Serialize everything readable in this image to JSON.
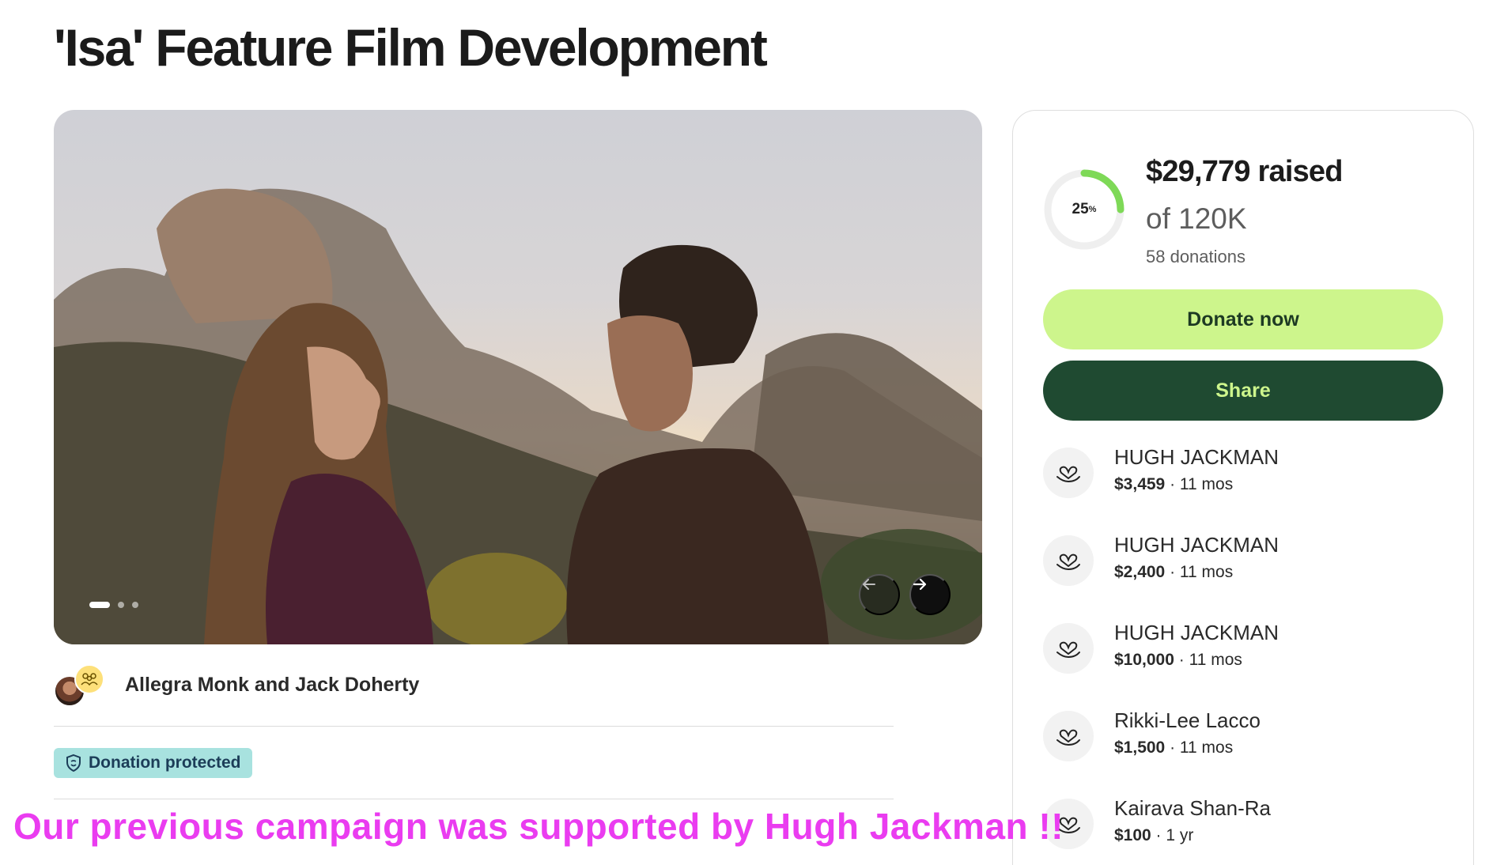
{
  "title": "'Isa' Feature Film Development",
  "gallery": {
    "slide_count": 3,
    "active_index": 0
  },
  "organizer": {
    "name": "Allegra Monk and Jack Doherty"
  },
  "protection": {
    "label": "Donation protected"
  },
  "overlay": {
    "text": "Our previous campaign was supported by Hugh Jackman !!"
  },
  "fundraiser": {
    "progress_percent": 25,
    "progress_label": "25",
    "progress_unit": "%",
    "raised_text": "$29,779 raised",
    "goal_text": "of 120K",
    "donations_text": "58 donations",
    "donate_label": "Donate now",
    "share_label": "Share"
  },
  "donations": [
    {
      "name": "HUGH JACKMAN",
      "amount": "$3,459",
      "age": "11 mos"
    },
    {
      "name": "HUGH JACKMAN",
      "amount": "$2,400",
      "age": "11 mos"
    },
    {
      "name": "HUGH JACKMAN",
      "amount": "$10,000",
      "age": "11 mos"
    },
    {
      "name": "Rikki-Lee Lacco",
      "amount": "$1,500",
      "age": "11 mos"
    },
    {
      "name": "Kairava Shan-Ra",
      "amount": "$100",
      "age": "1 yr"
    }
  ],
  "colors": {
    "accent_light": "#cdf58c",
    "accent_dark": "#1f4a31",
    "progress": "#7ed957",
    "overlay_text": "#ea3cf0",
    "badge_bg": "#a8e2df"
  },
  "icons": {
    "prev": "arrow-left-icon",
    "next": "arrow-right-icon",
    "shield": "shield-icon",
    "donor": "heart-hand-icon",
    "group": "people-group-icon"
  }
}
